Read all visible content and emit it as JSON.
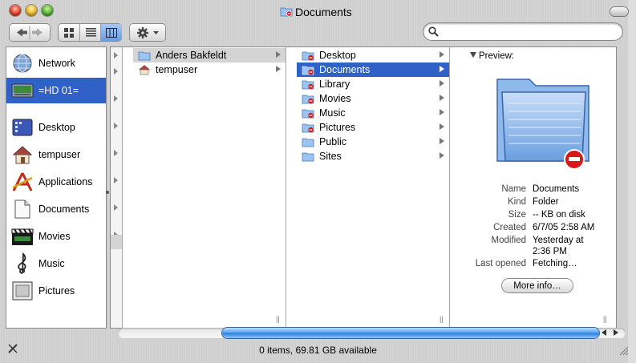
{
  "window": {
    "title": "Documents"
  },
  "sidebar": {
    "items": [
      {
        "label": "Network",
        "icon": "network-globe-icon",
        "selected": false
      },
      {
        "label": "=HD 01=",
        "icon": "hard-drive-icon",
        "selected": true
      },
      {
        "label": "Desktop",
        "icon": "desktop-icon",
        "selected": false
      },
      {
        "label": "tempuser",
        "icon": "home-icon",
        "selected": false
      },
      {
        "label": "Applications",
        "icon": "applications-icon",
        "selected": false
      },
      {
        "label": "Documents",
        "icon": "documents-icon",
        "selected": false
      },
      {
        "label": "Movies",
        "icon": "clapperboard-icon",
        "selected": false
      },
      {
        "label": "Music",
        "icon": "treble-clef-icon",
        "selected": false
      },
      {
        "label": "Pictures",
        "icon": "picture-frame-icon",
        "selected": false
      }
    ]
  },
  "columns": [
    {
      "items": [
        {
          "label": "Anders Bakfeldt",
          "icon": "folder-icon",
          "selected": "gray"
        },
        {
          "label": "tempuser",
          "icon": "home-icon",
          "selected": "none"
        }
      ]
    },
    {
      "items": [
        {
          "label": "Desktop",
          "icon": "restricted-folder-icon",
          "selected": "none"
        },
        {
          "label": "Documents",
          "icon": "restricted-folder-icon",
          "selected": "blue"
        },
        {
          "label": "Library",
          "icon": "restricted-folder-icon",
          "selected": "none"
        },
        {
          "label": "Movies",
          "icon": "restricted-folder-icon",
          "selected": "none"
        },
        {
          "label": "Music",
          "icon": "restricted-folder-icon",
          "selected": "none"
        },
        {
          "label": "Pictures",
          "icon": "restricted-folder-icon",
          "selected": "none"
        },
        {
          "label": "Public",
          "icon": "folder-icon",
          "selected": "none"
        },
        {
          "label": "Sites",
          "icon": "folder-icon",
          "selected": "none"
        }
      ]
    }
  ],
  "preview": {
    "header": "Preview:",
    "info": [
      {
        "label": "Name",
        "value": "Documents"
      },
      {
        "label": "Kind",
        "value": "Folder"
      },
      {
        "label": "Size",
        "value": "-- KB on disk"
      },
      {
        "label": "Created",
        "value": "6/7/05 2:58 AM"
      },
      {
        "label": "Modified",
        "value": "Yesterday at",
        "value2": "2:36 PM"
      },
      {
        "label": "Last opened",
        "value": "Fetching…"
      }
    ],
    "more_info_label": "More info…"
  },
  "status": {
    "text": "0 items, 69.81 GB available"
  },
  "colors": {
    "selection_blue": "#2f61c7",
    "selection_gray": "#d4d4d4",
    "scroll_thumb": "#5aa3ef"
  }
}
